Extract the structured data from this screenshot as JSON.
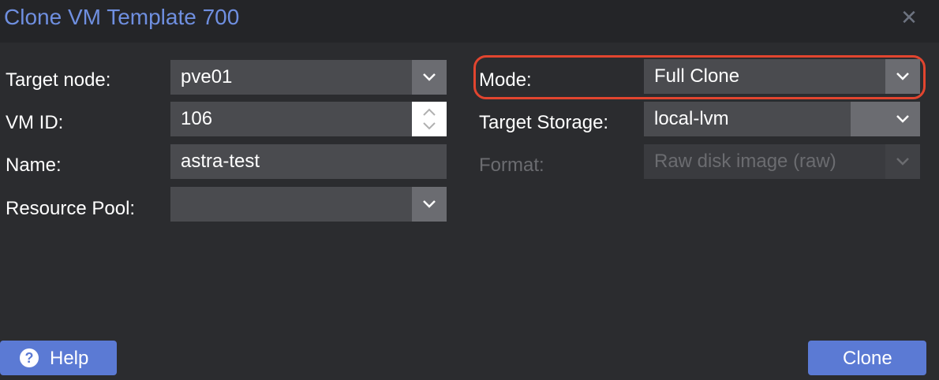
{
  "window": {
    "title": "Clone VM Template 700",
    "close_icon": "close-icon"
  },
  "form": {
    "target_node": {
      "label": "Target node:",
      "value": "pve01"
    },
    "vm_id": {
      "label": "VM ID:",
      "value": "106"
    },
    "name": {
      "label": "Name:",
      "value": "astra-test"
    },
    "resource_pool": {
      "label": "Resource Pool:",
      "value": ""
    },
    "mode": {
      "label": "Mode:",
      "value": "Full Clone"
    },
    "target_storage": {
      "label": "Target Storage:",
      "value": "local-lvm"
    },
    "format": {
      "label": "Format:",
      "value": "Raw disk image (raw)",
      "disabled": true
    }
  },
  "buttons": {
    "help": "Help",
    "clone": "Clone"
  },
  "colors": {
    "accent": "#5b7ad4",
    "title": "#6f8fe0",
    "highlight": "#e2452f",
    "background": "#2b2c2f"
  }
}
